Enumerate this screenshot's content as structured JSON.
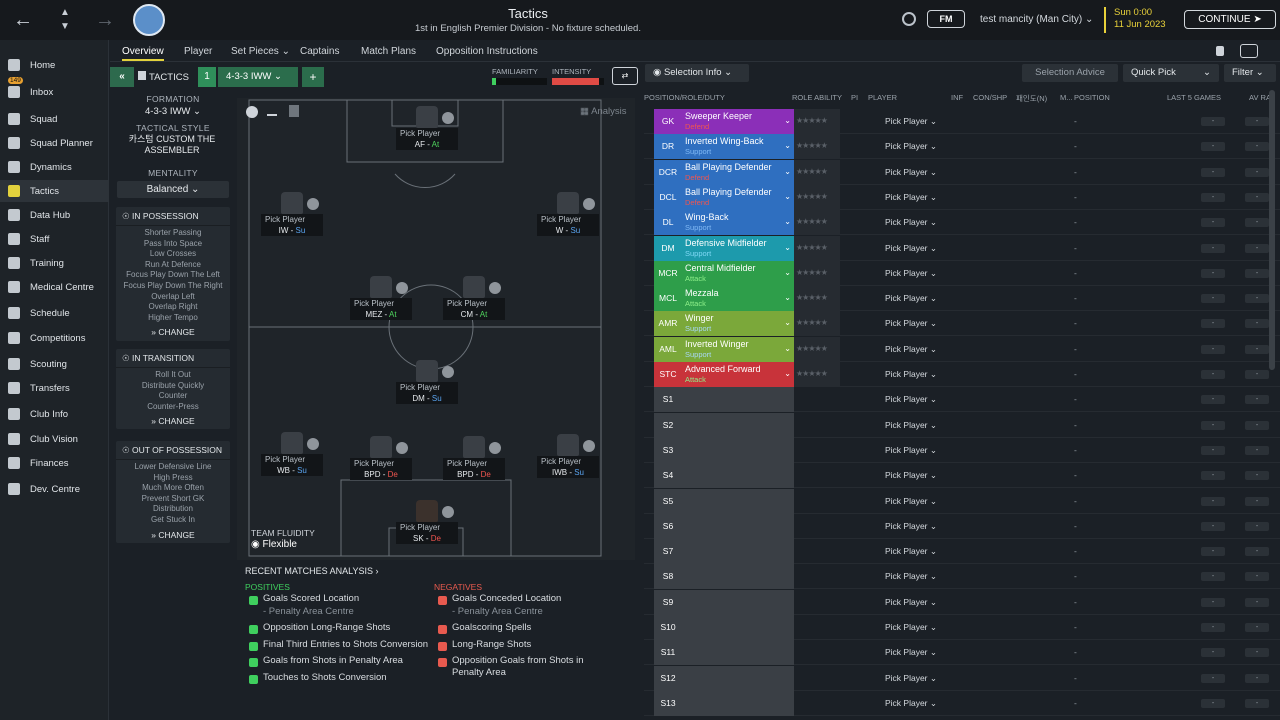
{
  "header": {
    "title": "Tactics",
    "subtitle": "1st in English Premier Division - No fixture scheduled.",
    "fm_logo": "FM",
    "manager": "test mancity (Man City)",
    "date_line1": "Sun 0:00",
    "date_line2": "11 Jun 2023",
    "continue_label": "CONTINUE"
  },
  "sidebar": {
    "inbox_count": "149",
    "items": [
      {
        "label": "Home",
        "icon": "home-icon"
      },
      {
        "label": "Inbox",
        "icon": "inbox-icon"
      },
      {
        "label": "Squad",
        "icon": "squad-icon"
      },
      {
        "label": "Squad Planner",
        "icon": "squad-planner-icon"
      },
      {
        "label": "Dynamics",
        "icon": "dynamics-icon"
      },
      {
        "label": "Tactics",
        "icon": "tactics-icon"
      },
      {
        "label": "Data Hub",
        "icon": "data-hub-icon"
      },
      {
        "label": "Staff",
        "icon": "staff-icon"
      },
      {
        "label": "Training",
        "icon": "training-icon"
      },
      {
        "label": "Medical Centre",
        "icon": "medical-icon"
      },
      {
        "label": "Schedule",
        "icon": "schedule-icon"
      },
      {
        "label": "Competitions",
        "icon": "trophy-icon"
      },
      {
        "label": "Scouting",
        "icon": "scouting-icon"
      },
      {
        "label": "Transfers",
        "icon": "transfers-icon"
      },
      {
        "label": "Club Info",
        "icon": "club-info-icon"
      },
      {
        "label": "Club Vision",
        "icon": "club-vision-icon"
      },
      {
        "label": "Finances",
        "icon": "finances-icon"
      },
      {
        "label": "Dev. Centre",
        "icon": "dev-centre-icon"
      }
    ]
  },
  "subnav": {
    "tabs": [
      "Overview",
      "Player",
      "Set Pieces",
      "Captains",
      "Match Plans",
      "Opposition Instructions"
    ]
  },
  "tactics_bar": {
    "label": "TACTICS",
    "slot": "1",
    "formation": "4-3-3 IWW"
  },
  "left_col": {
    "formation_label": "FORMATION",
    "formation_value": "4-3-3 IWW",
    "style_label": "TACTICAL STYLE",
    "style_value": "카스텀 CUSTOM THE ASSEMBLER",
    "mentality_label": "MENTALITY",
    "mentality_value": "Balanced",
    "in_possession": {
      "title": "IN POSSESSION",
      "items": [
        "Shorter Passing",
        "Pass Into Space",
        "Low Crosses",
        "Run At Defence",
        "Focus Play Down The Left",
        "Focus Play Down The Right",
        "Overlap Left",
        "Overlap Right",
        "Higher Tempo"
      ],
      "change": "CHANGE"
    },
    "in_transition": {
      "title": "IN TRANSITION",
      "items": [
        "Roll It Out",
        "Distribute Quickly",
        "Counter",
        "Counter-Press"
      ],
      "change": "CHANGE"
    },
    "out_of_possession": {
      "title": "OUT OF POSSESSION",
      "items": [
        "Lower Defensive Line",
        "High Press",
        "Much More Often",
        "Prevent Short GK",
        "Distribution",
        "Get Stuck In"
      ],
      "change": "CHANGE"
    }
  },
  "bars": {
    "familiarity_label": "FAMILIARITY",
    "familiarity_level": 0.08,
    "intensity_label": "INTENSITY",
    "intensity_level": 0.9
  },
  "pitch": {
    "analysis_label": "Analysis",
    "fluidity_label": "TEAM FLUIDITY",
    "fluidity_value": "Flexible",
    "pick_label": "Pick Player",
    "positions": [
      {
        "role": "AF",
        "duty": "At",
        "dutyClass": "at"
      },
      {
        "role": "IW",
        "duty": "Su",
        "dutyClass": "su"
      },
      {
        "role": "W",
        "duty": "Su",
        "dutyClass": "su"
      },
      {
        "role": "MEZ",
        "duty": "At",
        "dutyClass": "at"
      },
      {
        "role": "CM",
        "duty": "At",
        "dutyClass": "at"
      },
      {
        "role": "DM",
        "duty": "Su",
        "dutyClass": "su"
      },
      {
        "role": "WB",
        "duty": "Su",
        "dutyClass": "su"
      },
      {
        "role": "BPD",
        "duty": "De",
        "dutyClass": "de"
      },
      {
        "role": "BPD",
        "duty": "De",
        "dutyClass": "de"
      },
      {
        "role": "IWB",
        "duty": "Su",
        "dutyClass": "su"
      },
      {
        "role": "SK",
        "duty": "De",
        "dutyClass": "de"
      }
    ]
  },
  "analysis": {
    "title": "RECENT MATCHES ANALYSIS",
    "positives_label": "POSITIVES",
    "negatives_label": "NEGATIVES",
    "positives": [
      "Goals Scored Location",
      "Opposition Long-Range Shots",
      "Final Third Entries to Shots Conversion",
      "Goals from Shots in Penalty Area",
      "Touches to Shots Conversion"
    ],
    "positives_sub": "- Penalty Area Centre",
    "negatives": [
      "Goals Conceded Location",
      "Goalscoring Spells",
      "Long-Range Shots",
      "Opposition Goals from Shots in",
      "Penalty Area"
    ],
    "negatives_sub": "- Penalty Area Centre"
  },
  "table": {
    "selection_info": "Selection Info",
    "selection_advice": "Selection Advice",
    "quick_pick": "Quick Pick",
    "filter": "Filter",
    "headers": [
      "POSITION/ROLE/DUTY",
      "ROLE ABILITY",
      "PI",
      "PLAYER",
      "INF",
      "CON/SHP",
      "패인도(N)",
      "M...",
      "POSITION",
      "LAST 5 GAMES",
      "AV RAT"
    ],
    "pick_label": "Pick Player",
    "dash": "-",
    "starters": [
      {
        "pos": "GK",
        "role": "Sweeper Keeper",
        "duty": "Defend",
        "color": "#8b2fb8",
        "dutyColor": "#f0554f"
      },
      {
        "pos": "DR",
        "role": "Inverted Wing-Back",
        "duty": "Support",
        "color": "#2f6fc0",
        "dutyColor": "#7fb8f5"
      },
      {
        "pos": "DCR",
        "role": "Ball Playing Defender",
        "duty": "Defend",
        "color": "#2f6fc0",
        "dutyColor": "#f0554f"
      },
      {
        "pos": "DCL",
        "role": "Ball Playing Defender",
        "duty": "Defend",
        "color": "#2f6fc0",
        "dutyColor": "#f0554f"
      },
      {
        "pos": "DL",
        "role": "Wing-Back",
        "duty": "Support",
        "color": "#2f6fc0",
        "dutyColor": "#7fb8f5"
      },
      {
        "pos": "DM",
        "role": "Defensive Midfielder",
        "duty": "Support",
        "color": "#1d9aac",
        "dutyColor": "#7fd8f5"
      },
      {
        "pos": "MCR",
        "role": "Central Midfielder",
        "duty": "Attack",
        "color": "#2e9e4a",
        "dutyColor": "#8ef08a"
      },
      {
        "pos": "MCL",
        "role": "Mezzala",
        "duty": "Attack",
        "color": "#2e9e4a",
        "dutyColor": "#8ef08a"
      },
      {
        "pos": "AMR",
        "role": "Winger",
        "duty": "Support",
        "color": "#7ba83a",
        "dutyColor": "#a8d8f5"
      },
      {
        "pos": "AML",
        "role": "Inverted Winger",
        "duty": "Support",
        "color": "#7ba83a",
        "dutyColor": "#a8d8f5"
      },
      {
        "pos": "STC",
        "role": "Advanced Forward",
        "duty": "Attack",
        "color": "#c8333a",
        "dutyColor": "#8ef08a"
      }
    ],
    "subs": [
      "S1",
      "S2",
      "S3",
      "S4",
      "S5",
      "S6",
      "S7",
      "S8",
      "S9",
      "S10",
      "S11",
      "S12",
      "S13"
    ]
  }
}
